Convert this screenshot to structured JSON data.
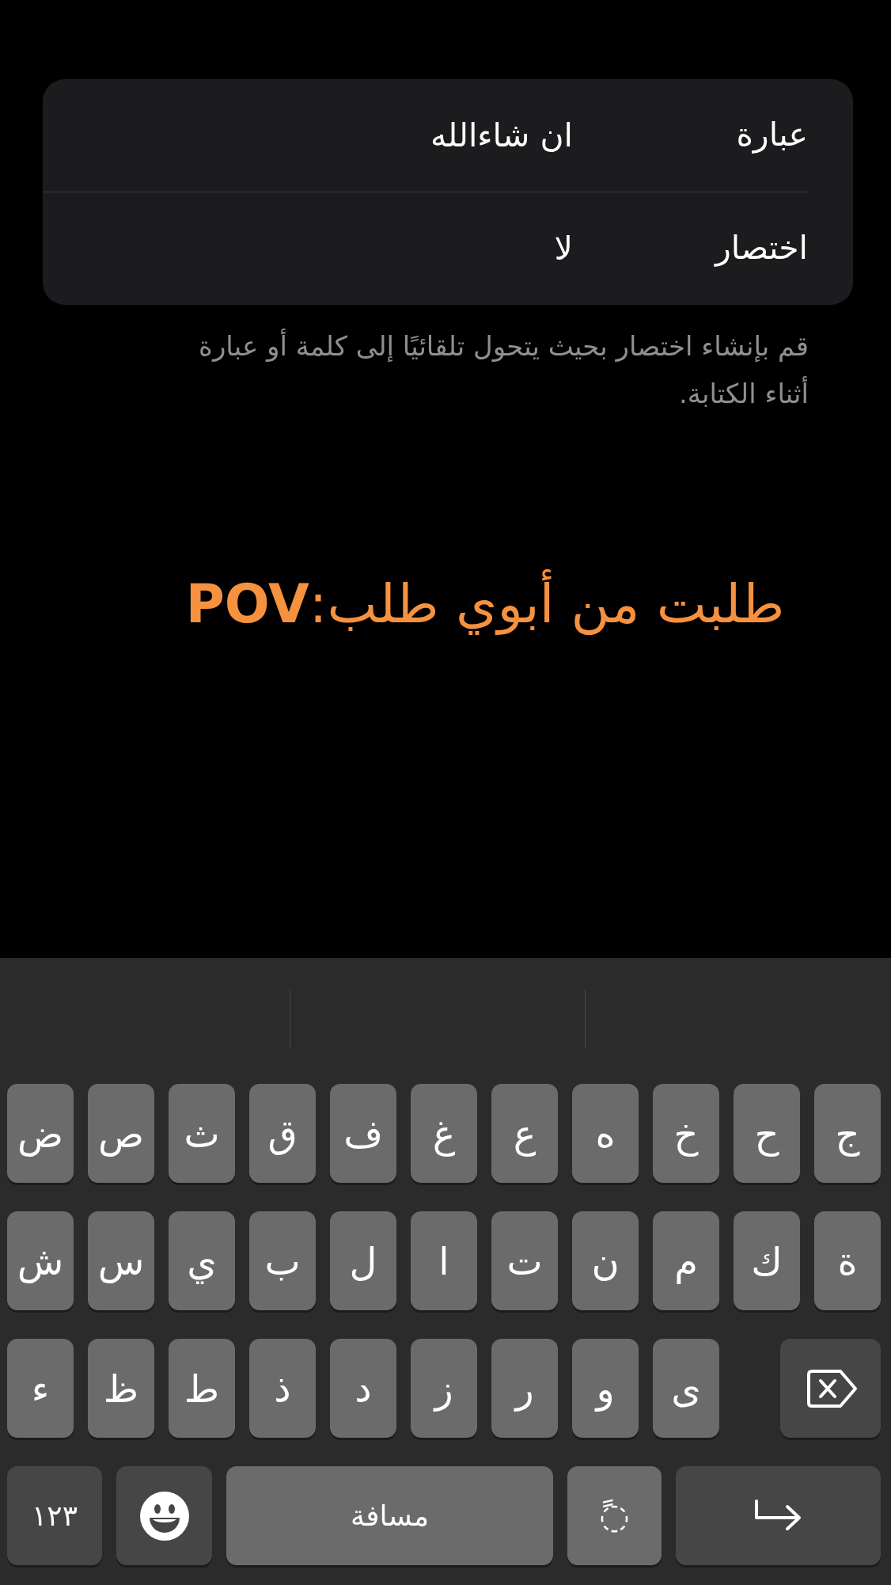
{
  "card": {
    "rows": [
      {
        "label": "عبارة",
        "value": "ان شاءالله"
      },
      {
        "label": "اختصار",
        "value": "لا"
      }
    ]
  },
  "footnote": "قم بإنشاء اختصار بحيث يتحول تلقائيًا إلى كلمة أو عبارة أثناء الكتابة.",
  "caption": "طلبت من أبوي طلب:**POV**",
  "keyboard": {
    "top_row": [
      {
        "kind": "letter",
        "label": "ج"
      },
      {
        "kind": "letter",
        "label": "ح"
      },
      {
        "kind": "letter",
        "label": "خ"
      },
      {
        "kind": "letter",
        "label": "ه"
      },
      {
        "kind": "letter",
        "label": "ع"
      },
      {
        "kind": "letter",
        "label": "غ"
      },
      {
        "kind": "letter",
        "label": "ف"
      },
      {
        "kind": "letter",
        "label": "ق"
      },
      {
        "kind": "letter",
        "label": "ث"
      },
      {
        "kind": "letter",
        "label": "ص"
      },
      {
        "kind": "letter",
        "label": "ض"
      }
    ],
    "middle_row": [
      {
        "kind": "letter",
        "label": "ة"
      },
      {
        "kind": "letter",
        "label": "ك"
      },
      {
        "kind": "letter",
        "label": "م"
      },
      {
        "kind": "letter",
        "label": "ن"
      },
      {
        "kind": "letter",
        "label": "ت"
      },
      {
        "kind": "letter",
        "label": "ا"
      },
      {
        "kind": "letter",
        "label": "ل"
      },
      {
        "kind": "letter",
        "label": "ب"
      },
      {
        "kind": "letter",
        "label": "ي"
      },
      {
        "kind": "letter",
        "label": "س"
      },
      {
        "kind": "letter",
        "label": "ش"
      }
    ],
    "lower_row": [
      {
        "kind": "delete"
      },
      {
        "kind": "letter",
        "label": "ى"
      },
      {
        "kind": "letter",
        "label": "و"
      },
      {
        "kind": "letter",
        "label": "ر"
      },
      {
        "kind": "letter",
        "label": "ز"
      },
      {
        "kind": "letter",
        "label": "د"
      },
      {
        "kind": "letter",
        "label": "ذ"
      },
      {
        "kind": "letter",
        "label": "ط"
      },
      {
        "kind": "letter",
        "label": "ظ"
      },
      {
        "kind": "letter",
        "label": "ء"
      }
    ],
    "bottom_row": [
      {
        "kind": "return"
      },
      {
        "kind": "diacritic",
        "label": "◌ً"
      },
      {
        "kind": "space",
        "label": "مسافة"
      },
      {
        "kind": "emoji"
      },
      {
        "kind": "numbers",
        "label": "١٢٣"
      }
    ]
  }
}
